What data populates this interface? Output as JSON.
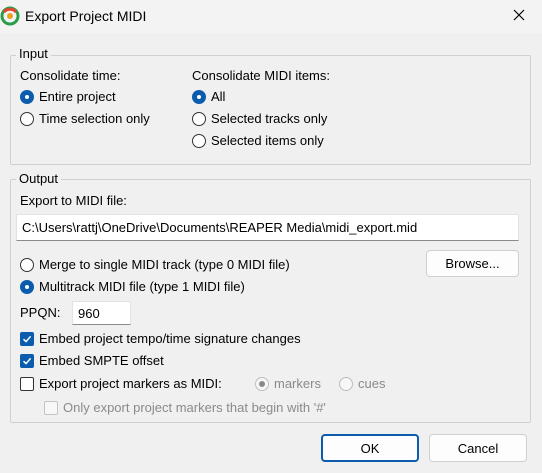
{
  "window": {
    "title": "Export Project MIDI"
  },
  "input": {
    "legend": "Input",
    "time_label": "Consolidate time:",
    "time_options": [
      {
        "label": "Entire project",
        "selected": true
      },
      {
        "label": "Time selection only",
        "selected": false
      }
    ],
    "items_label": "Consolidate MIDI items:",
    "items_options": [
      {
        "label": "All",
        "selected": true
      },
      {
        "label": "Selected tracks only",
        "selected": false
      },
      {
        "label": "Selected items only",
        "selected": false
      }
    ]
  },
  "output": {
    "legend": "Output",
    "file_label": "Export to MIDI file:",
    "file_path": "C:\\Users\\rattj\\OneDrive\\Documents\\REAPER Media\\midi_export.mid",
    "browse_label": "Browse...",
    "format_options": [
      {
        "label": "Merge to single MIDI track (type 0 MIDI file)",
        "selected": false
      },
      {
        "label": "Multitrack MIDI file (type 1 MIDI file)",
        "selected": true
      }
    ],
    "ppqn_label": "PPQN:",
    "ppqn_value": "960",
    "embed_tempo": {
      "label": "Embed project tempo/time signature changes",
      "checked": true
    },
    "embed_smpte": {
      "label": "Embed SMPTE offset",
      "checked": true
    },
    "export_markers": {
      "label": "Export project markers as MIDI:",
      "checked": false
    },
    "marker_type_options": [
      {
        "label": "markers",
        "selected": true,
        "disabled": true
      },
      {
        "label": "cues",
        "selected": false,
        "disabled": true
      }
    ],
    "only_hash_markers": {
      "label": "Only export project markers that begin with '#'",
      "checked": false,
      "disabled": true
    }
  },
  "buttons": {
    "ok": "OK",
    "cancel": "Cancel"
  },
  "colors": {
    "accent": "#0b5cad",
    "background": "#f0f0f0",
    "disabled_text": "#8a8a8a"
  }
}
